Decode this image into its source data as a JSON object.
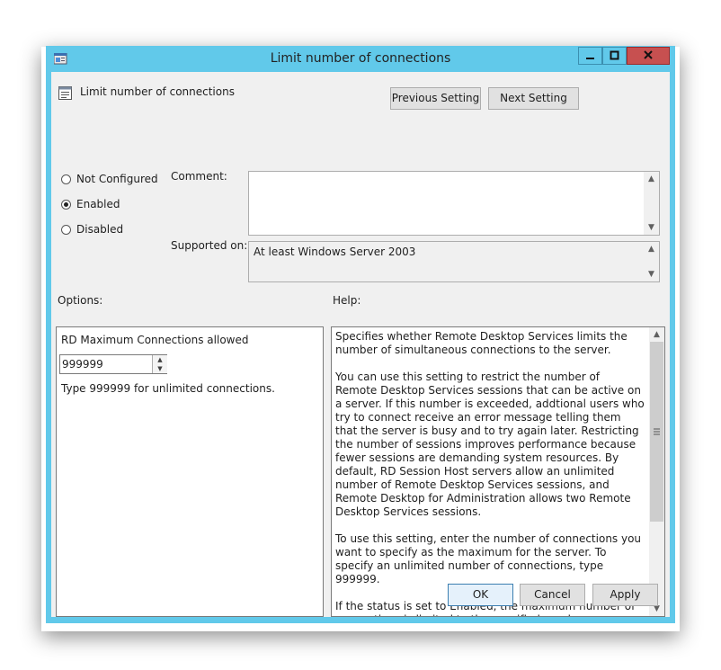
{
  "window": {
    "title": "Limit number of connections",
    "accent_color": "#61c9ea",
    "close_color": "#c75050"
  },
  "header": {
    "policy_name": "Limit number of connections",
    "previous_label": "Previous Setting",
    "next_label": "Next Setting"
  },
  "state": {
    "not_configured": "Not Configured",
    "enabled": "Enabled",
    "disabled": "Disabled",
    "selected": "enabled"
  },
  "comment": {
    "label": "Comment:",
    "value": ""
  },
  "supported": {
    "label": "Supported on:",
    "value": "At least Windows Server 2003"
  },
  "options": {
    "label": "Options:",
    "max_connections_label": "RD Maximum Connections allowed",
    "max_connections_value": "999999",
    "hint": "Type 999999 for unlimited connections."
  },
  "help": {
    "label": "Help:",
    "paragraphs": [
      "Specifies whether Remote Desktop Services limits the number of simultaneous connections to the server.",
      "You can use this setting to restrict the number of Remote Desktop Services sessions that can be active on a server. If this number is exceeded, addtional users who try to connect receive an error message telling them that the server is busy and to try again later. Restricting the number of sessions improves performance because fewer sessions are demanding system resources. By default, RD Session Host servers allow an unlimited number of Remote Desktop Services sessions, and Remote Desktop for Administration allows two Remote Desktop Services sessions.",
      "To use this setting, enter the number of connections you want to specify as the maximum for the server. To specify an unlimited number of connections, type 999999.",
      "If the status is set to Enabled, the maximum number of connections is limited to the specified number consistent with the version of Windows and the mode of Remote Desktop"
    ]
  },
  "footer": {
    "ok": "OK",
    "cancel": "Cancel",
    "apply": "Apply"
  }
}
